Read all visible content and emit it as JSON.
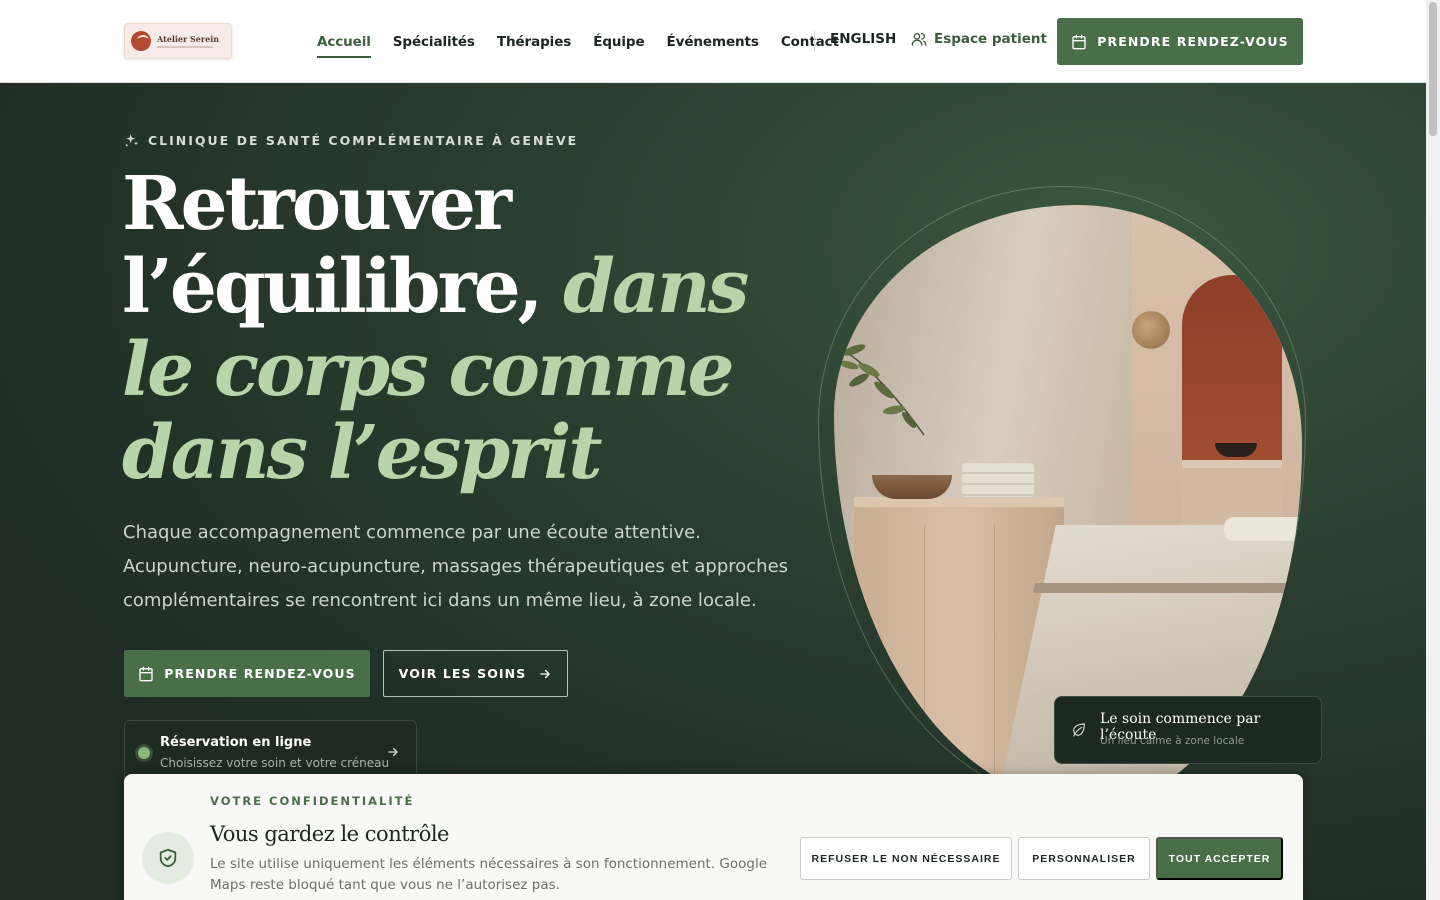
{
  "header": {
    "logo_name": "Atelier Serein",
    "nav": [
      {
        "label": "Accueil",
        "active": true
      },
      {
        "label": "Spécialités",
        "active": false
      },
      {
        "label": "Thérapies",
        "active": false
      },
      {
        "label": "Équipe",
        "active": false
      },
      {
        "label": "Événements",
        "active": false
      },
      {
        "label": "Contact",
        "active": false
      }
    ],
    "lang": "ENGLISH",
    "patient_label": "Espace patient",
    "cta_label": "PRENDRE RENDEZ-VOUS"
  },
  "hero": {
    "eyebrow": "CLINIQUE DE SANTÉ COMPLÉMENTAIRE À GENÈVE",
    "title_line1": "Retrouver",
    "title_line2a": "l’équilibre,",
    "title_line2b": "dans",
    "title_line3": "le corps comme",
    "title_line4": "dans l’esprit",
    "lead": "Chaque accompagnement commence par une écoute attentive. Acupuncture, neuro-acupuncture, massages thérapeutiques et approches complémentaires se rencontrent ici dans un même lieu, à zone locale.",
    "primary_btn": "PRENDRE RENDEZ-VOUS",
    "secondary_btn": "VOIR LES SOINS",
    "reservation": {
      "title": "Réservation en ligne",
      "subtitle": "Choisissez votre soin et votre créneau"
    },
    "quote": {
      "title": "Le soin commence par l’écoute",
      "subtitle": "Un lieu calme à zone locale"
    }
  },
  "cookie": {
    "eyebrow": "VOTRE CONFIDENTIALITÉ",
    "title": "Vous gardez le contrôle",
    "text": "Le site utilise uniquement les éléments nécessaires à son fonctionnement. Google Maps reste bloqué tant que vous ne l’autorisez pas.",
    "refuse_label": "REFUSER LE NON NÉCESSAIRE",
    "custom_label": "PERSONNALISER",
    "accept_label": "TOUT ACCEPTER"
  },
  "colors": {
    "brand_green": "#4a6e48",
    "hero_bg": "#1f2b23",
    "accent_light_green": "#b9d4a8"
  }
}
